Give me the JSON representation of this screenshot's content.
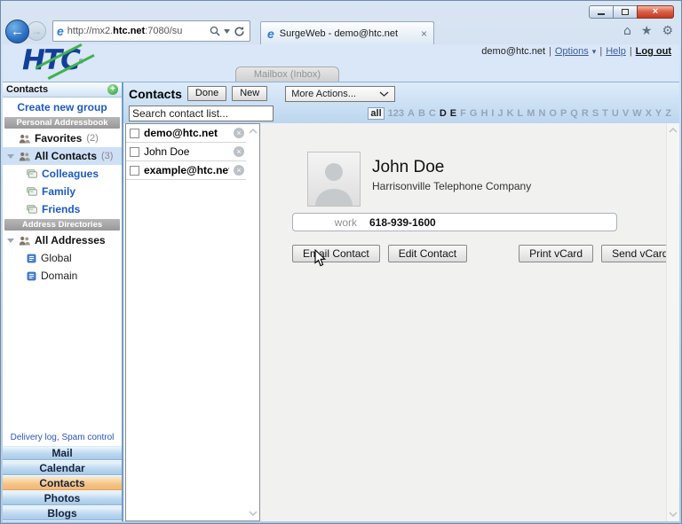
{
  "browser": {
    "url_prefix": "http://mx2.",
    "url_domain": "htc.net",
    "url_suffix": ":7080/su",
    "tab_title": "SurgeWeb - demo@htc.net"
  },
  "icons": {
    "back": "←",
    "forward": "→",
    "home": "⌂",
    "star": "★",
    "gear": "⚙",
    "close": "×",
    "tab_close": "×",
    "ie": "e",
    "caret_down": "▾",
    "plus": "+",
    "delete": "×"
  },
  "account_bar": {
    "email": "demo@htc.net",
    "options": "Options",
    "help": "Help",
    "logout": "Log out",
    "separator": "|"
  },
  "brand": {
    "logo_text": "HTC",
    "registered": "®"
  },
  "mailbox_tab": "Mailbox (Inbox)",
  "sidebar": {
    "title": "Contacts",
    "create_group": "Create new group",
    "personal_section": "Personal Addressbook",
    "favorites_label": "Favorites",
    "favorites_count": "(2)",
    "all_contacts_label": "All Contacts",
    "all_contacts_count": "(3)",
    "groups": [
      "Colleagues",
      "Family",
      "Friends"
    ],
    "directories_section": "Address Directories",
    "all_addresses_label": "All Addresses",
    "directories": [
      "Global",
      "Domain"
    ],
    "footer_links": [
      "Delivery log",
      "Spam control"
    ],
    "footer_separator": ",",
    "nav": [
      {
        "label": "Mail",
        "active": false
      },
      {
        "label": "Calendar",
        "active": false
      },
      {
        "label": "Contacts",
        "active": true
      },
      {
        "label": "Photos",
        "active": false
      },
      {
        "label": "Blogs",
        "active": false
      }
    ]
  },
  "toolbar": {
    "title": "Contacts",
    "done": "Done",
    "new": "New",
    "more_actions": "More Actions...",
    "search_placeholder": "Search contact list..."
  },
  "alphabet": {
    "items": [
      {
        "label": "all",
        "state": "selected"
      },
      {
        "label": "123",
        "state": "dim"
      },
      {
        "label": "A",
        "state": "dim"
      },
      {
        "label": "B",
        "state": "dim"
      },
      {
        "label": "C",
        "state": "dim"
      },
      {
        "label": "D",
        "state": "active"
      },
      {
        "label": "E",
        "state": "active"
      },
      {
        "label": "F",
        "state": "dim"
      },
      {
        "label": "G",
        "state": "dim"
      },
      {
        "label": "H",
        "state": "dim"
      },
      {
        "label": "I",
        "state": "dim"
      },
      {
        "label": "J",
        "state": "dim"
      },
      {
        "label": "K",
        "state": "dim"
      },
      {
        "label": "L",
        "state": "dim"
      },
      {
        "label": "M",
        "state": "dim"
      },
      {
        "label": "N",
        "state": "dim"
      },
      {
        "label": "O",
        "state": "dim"
      },
      {
        "label": "P",
        "state": "dim"
      },
      {
        "label": "Q",
        "state": "dim"
      },
      {
        "label": "R",
        "state": "dim"
      },
      {
        "label": "S",
        "state": "dim"
      },
      {
        "label": "T",
        "state": "dim"
      },
      {
        "label": "U",
        "state": "dim"
      },
      {
        "label": "V",
        "state": "dim"
      },
      {
        "label": "W",
        "state": "dim"
      },
      {
        "label": "X",
        "state": "dim"
      },
      {
        "label": "Y",
        "state": "dim"
      },
      {
        "label": "Z",
        "state": "dim"
      }
    ]
  },
  "contacts": [
    {
      "name": "demo@htc.net"
    },
    {
      "name": "John Doe"
    },
    {
      "name": "example@htc.net"
    }
  ],
  "detail": {
    "name": "John Doe",
    "company": "Harrisonville Telephone Company",
    "phone_label": "work",
    "phone_value": "618-939-1600",
    "buttons": [
      "Email Contact",
      "Edit Contact",
      "Print vCard",
      "Send vCard"
    ]
  },
  "colors": {
    "accent_blue": "#1b5ac2",
    "header_band": "#d9e7f8",
    "active_nav_orange": "#f5c284",
    "logo_blue": "#113f9a",
    "logo_green": "#43b14c"
  }
}
